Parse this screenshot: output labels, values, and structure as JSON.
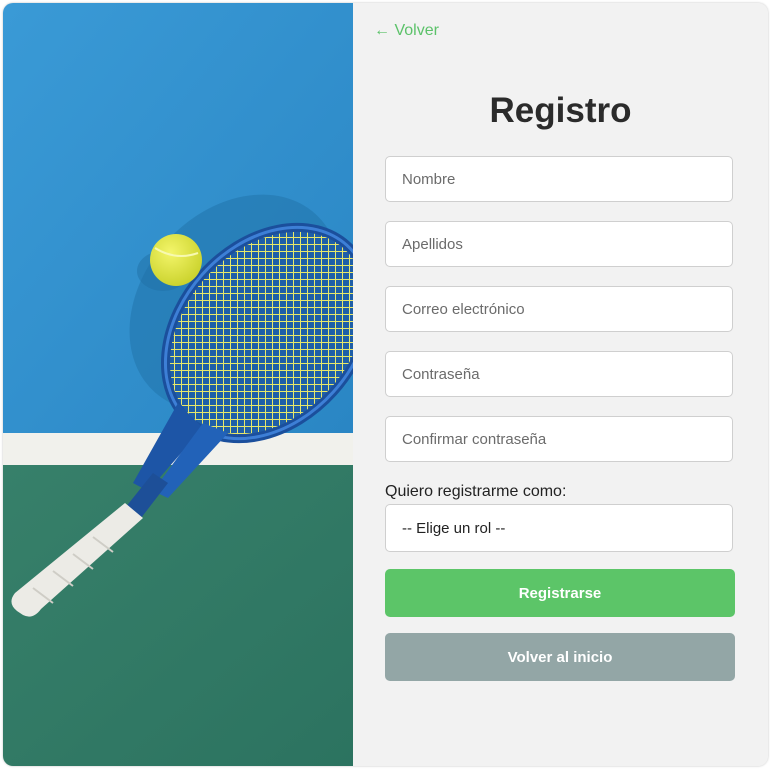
{
  "nav": {
    "back_label": "← Volver"
  },
  "form": {
    "title": "Registro",
    "fields": [
      {
        "placeholder": "Nombre",
        "value": ""
      },
      {
        "placeholder": "Apellidos",
        "value": ""
      },
      {
        "placeholder": "Correo electrónico",
        "value": ""
      },
      {
        "placeholder": "Contraseña",
        "value": ""
      },
      {
        "placeholder": "Confirmar contraseña",
        "value": ""
      }
    ],
    "role_label": "Quiero registrarme como:",
    "role_selected": "-- Elige un rol --",
    "submit_label": "Registrarse",
    "home_label": "Volver al inicio"
  },
  "colors": {
    "accent": "#5cc568",
    "secondary": "#93a6a6",
    "court_blue": "#2f8fcf",
    "court_green": "#2f7a62"
  },
  "image": {
    "subject": "tennis-racket-and-ball-on-court"
  }
}
